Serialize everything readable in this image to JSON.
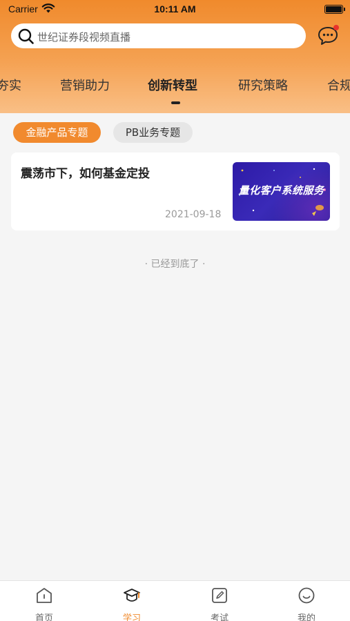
{
  "status_bar": {
    "carrier": "Carrier",
    "time": "10:11 AM"
  },
  "search": {
    "placeholder": "世纪证券段视频直播"
  },
  "category_tabs": [
    {
      "label": "夯实"
    },
    {
      "label": "营销助力"
    },
    {
      "label": "创新转型",
      "active": true
    },
    {
      "label": "研究策略"
    },
    {
      "label": "合规"
    }
  ],
  "sub_tabs": [
    {
      "label": "金融产品专题",
      "active": true
    },
    {
      "label": "PB业务专题"
    }
  ],
  "articles": [
    {
      "title": "震荡市下，如何基金定投",
      "date": "2021-09-18",
      "thumbnail_text": "量化客户系统服务"
    }
  ],
  "list_end_text": "· 已经到底了 ·",
  "tabbar": [
    {
      "label": "首页",
      "icon": "home-icon"
    },
    {
      "label": "学习",
      "icon": "graduation-cap-icon",
      "active": true
    },
    {
      "label": "考试",
      "icon": "edit-icon"
    },
    {
      "label": "我的",
      "icon": "smile-icon"
    }
  ],
  "colors": {
    "accent": "#f08a2c",
    "badge": "#e8332b",
    "thumb_bg": "#2d1aa6"
  }
}
